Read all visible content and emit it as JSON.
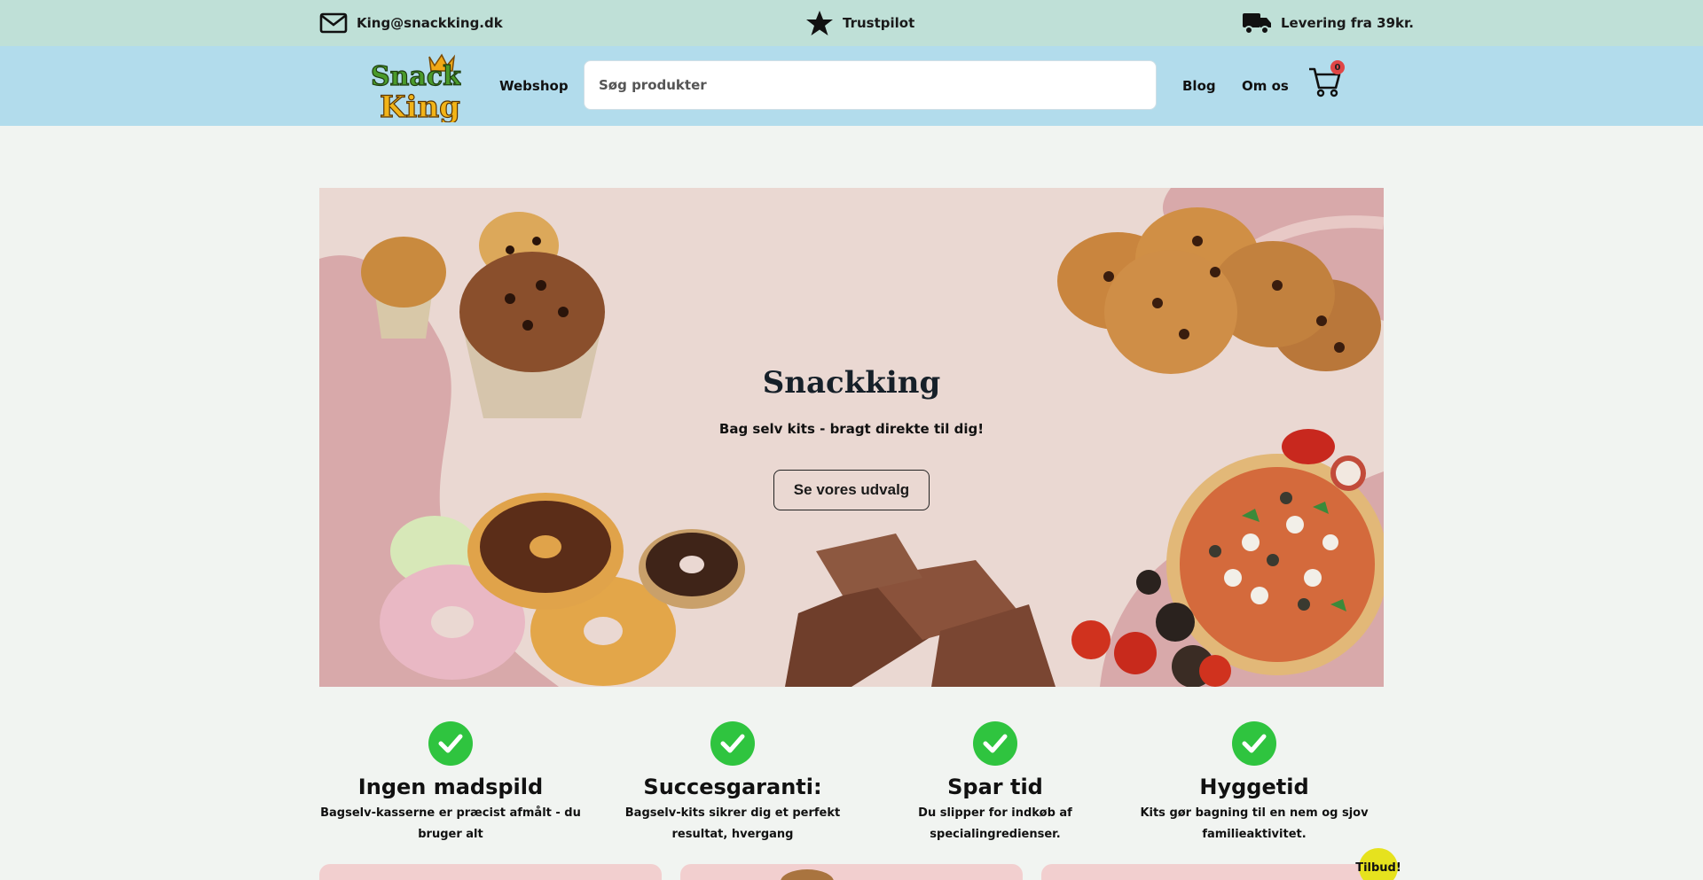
{
  "topbar": {
    "email": "King@snackking.dk",
    "trustpilot": "Trustpilot",
    "delivery": "Levering fra 39kr."
  },
  "nav": {
    "logo_line1": "Snack",
    "logo_line2": "King",
    "webshop": "Webshop",
    "search_placeholder": "Søg produkter",
    "blog": "Blog",
    "about": "Om os",
    "cart_count": "0"
  },
  "hero": {
    "title": "Snackking",
    "subtitle": "Bag selv kits - bragt direkte til dig!",
    "button": "Se vores udvalg"
  },
  "features": [
    {
      "title": "Ingen madspild",
      "text": "Bagselv-kasserne er præcist afmålt - du bruger alt"
    },
    {
      "title": "Succesgaranti:",
      "text": "Bagselv-kits sikrer dig et perfekt resultat, hvergang"
    },
    {
      "title": "Spar tid",
      "text": "Du slipper for indkøb af specialingredienser."
    },
    {
      "title": "Hyggetid",
      "text": "Kits gør bagning til en nem og sjov familieaktivitet."
    }
  ],
  "badge": "Tilbud!",
  "colors": {
    "topbar": "#bfe0d7",
    "navbar": "#b2dcec",
    "check": "#2fc43f",
    "badge": "#e6e21e"
  }
}
